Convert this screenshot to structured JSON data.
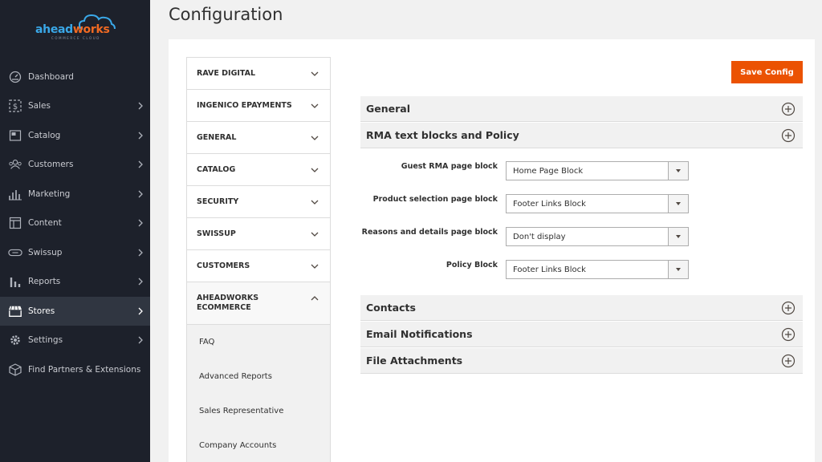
{
  "logo": {
    "part1": "ahead",
    "part2": "works",
    "sub": "COMMERCE CLOUD"
  },
  "sidebar": {
    "items": [
      {
        "label": "Dashboard",
        "icon": "dashboard-icon"
      },
      {
        "label": "Sales",
        "icon": "dollar-icon"
      },
      {
        "label": "Catalog",
        "icon": "catalog-icon"
      },
      {
        "label": "Customers",
        "icon": "customers-icon"
      },
      {
        "label": "Marketing",
        "icon": "marketing-icon"
      },
      {
        "label": "Content",
        "icon": "content-icon"
      },
      {
        "label": "Swissup",
        "icon": "swissup-icon"
      },
      {
        "label": "Reports",
        "icon": "reports-icon"
      },
      {
        "label": "Stores",
        "icon": "stores-icon"
      },
      {
        "label": "Settings",
        "icon": "gear-icon"
      },
      {
        "label": "Find Partners & Extensions",
        "icon": "box-icon"
      }
    ],
    "active": "Stores"
  },
  "page": {
    "title": "Configuration"
  },
  "tabs": [
    "RAVE DIGITAL",
    "INGENICO EPAYMENTS",
    "GENERAL",
    "CATALOG",
    "SECURITY",
    "SWISSUP",
    "CUSTOMERS"
  ],
  "open_tab": {
    "line1": "AHEADWORKS",
    "line2": "ECOMMERCE"
  },
  "sub_items": [
    "FAQ",
    "Advanced Reports",
    "Sales Representative",
    "Company Accounts"
  ],
  "toolbar": {
    "save_label": "Save Config"
  },
  "sections": {
    "general": "General",
    "rma": "RMA text blocks and Policy",
    "contacts": "Contacts",
    "email": "Email Notifications",
    "files": "File Attachments"
  },
  "fields": [
    {
      "label": "Guest RMA page block",
      "value": "Home Page Block"
    },
    {
      "label": "Product selection page block",
      "value": "Footer Links Block"
    },
    {
      "label": "Reasons and details page block",
      "value": "Don't display"
    },
    {
      "label": "Policy Block",
      "value": "Footer Links Block"
    }
  ],
  "colors": {
    "sidebar_bg": "#1d212b",
    "accent": "#eb5202",
    "logo_blue": "#3aa8e8",
    "logo_orange": "#f26a22"
  }
}
